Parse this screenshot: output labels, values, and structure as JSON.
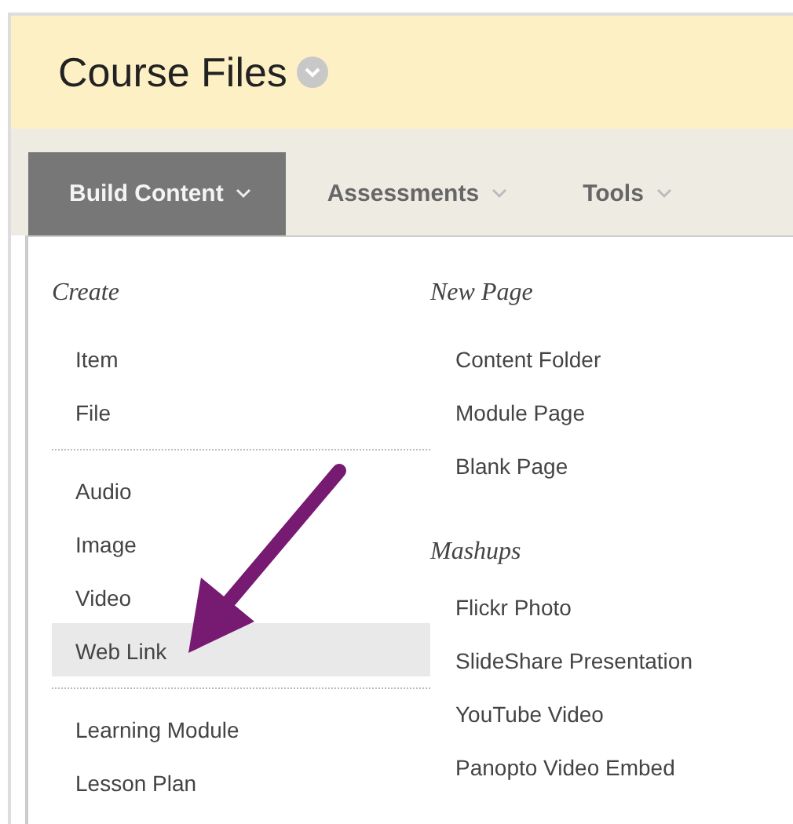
{
  "header": {
    "title": "Course Files"
  },
  "tabs": [
    {
      "label": "Build Content",
      "selected": true
    },
    {
      "label": "Assessments",
      "selected": false
    },
    {
      "label": "Tools",
      "selected": false
    }
  ],
  "menu": {
    "columns": [
      {
        "sections": [
          {
            "heading": "Create",
            "items": [
              {
                "label": "Item",
                "selected": false
              },
              {
                "label": "File",
                "selected": false
              }
            ]
          },
          {
            "items": [
              {
                "label": "Audio",
                "selected": false
              },
              {
                "label": "Image",
                "selected": false
              },
              {
                "label": "Video",
                "selected": false
              },
              {
                "label": "Web Link",
                "selected": true
              }
            ]
          },
          {
            "items": [
              {
                "label": "Learning Module",
                "selected": false
              },
              {
                "label": "Lesson Plan",
                "selected": false
              }
            ]
          }
        ]
      },
      {
        "sections": [
          {
            "heading": "New Page",
            "items": [
              {
                "label": "Content Folder",
                "selected": false
              },
              {
                "label": "Module Page",
                "selected": false
              },
              {
                "label": "Blank Page",
                "selected": false
              }
            ]
          },
          {
            "heading": "Mashups",
            "items": [
              {
                "label": "Flickr Photo",
                "selected": false
              },
              {
                "label": "SlideShare Presentation",
                "selected": false
              },
              {
                "label": "YouTube Video",
                "selected": false
              },
              {
                "label": "Panopto Video Embed",
                "selected": false
              }
            ]
          }
        ]
      }
    ]
  }
}
